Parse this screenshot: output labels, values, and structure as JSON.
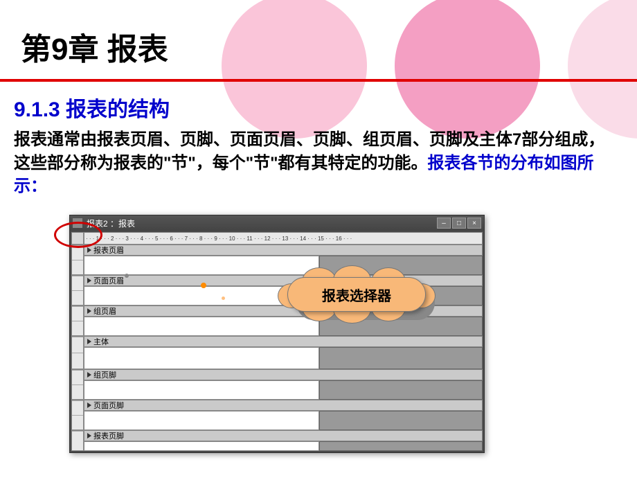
{
  "chapter": {
    "title": "第9章  报表"
  },
  "section": {
    "title": "9.1.3  报表的结构"
  },
  "body": {
    "text1": "报表通常由报表页眉、页脚、页面页眉、页脚、组页眉、页脚及主体7部分组成，这些部分称为报表的\"节\"，每个\"节\"都有其特定的功能。",
    "text2": "报表各节的分布如图所示："
  },
  "window": {
    "title": "报表2 ：报表",
    "ruler": "· · · 1 · · · 2 · · · 3 · · · 4 · · · 5 · · · 6 · · · 7 · · · 8 · · · 9 · · · 10 · · · 11 · · · 12 · · · 13 · · · 14 · · · 15 · · · 16 · · ·",
    "sections": [
      {
        "label": "报表页眉"
      },
      {
        "label": "页面页眉"
      },
      {
        "label": "组页眉"
      },
      {
        "label": "主体"
      },
      {
        "label": "组页脚"
      },
      {
        "label": "页面页脚"
      },
      {
        "label": "报表页脚"
      }
    ],
    "buttons": {
      "min": "–",
      "max": "□",
      "close": "×"
    }
  },
  "callout": {
    "label": "报表选择器"
  }
}
